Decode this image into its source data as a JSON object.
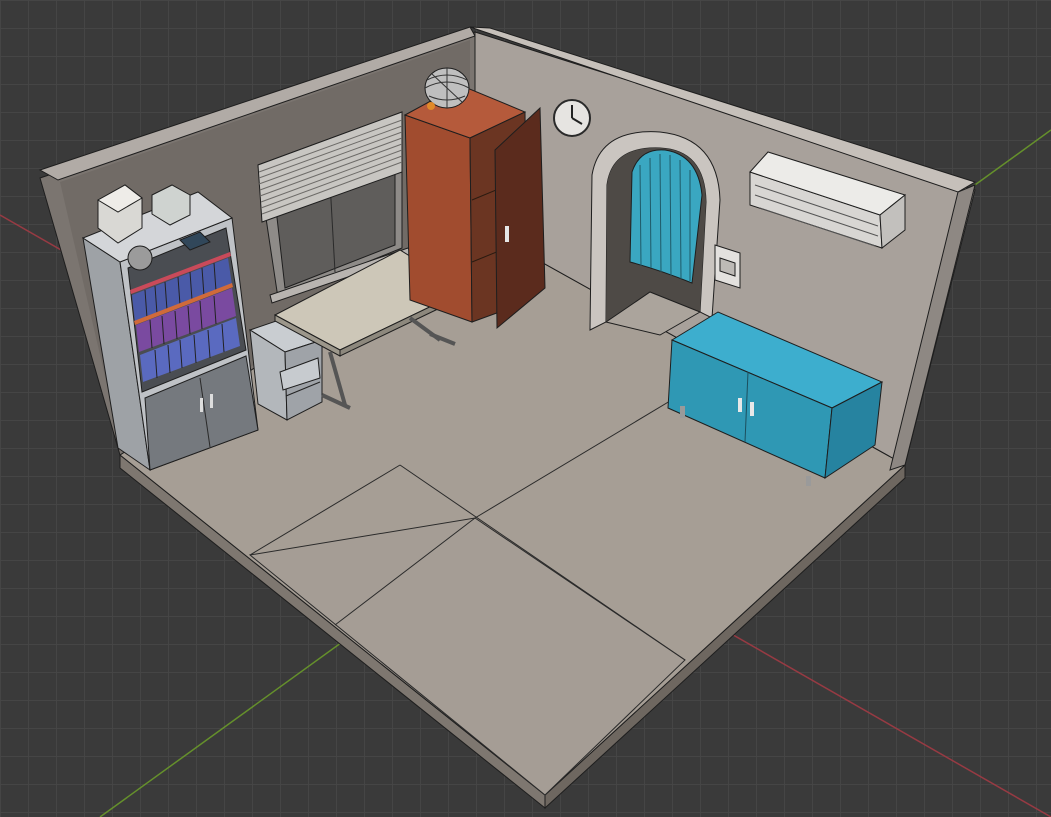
{
  "app": "3D viewport",
  "scene": {
    "type": "isometric room model",
    "objects": [
      {
        "name": "bookshelf",
        "icon": "bookshelf-icon"
      },
      {
        "name": "window-with-blinds",
        "icon": "window-icon"
      },
      {
        "name": "desk",
        "icon": "desk-icon"
      },
      {
        "name": "drawer-unit",
        "icon": "drawer-icon"
      },
      {
        "name": "wardrobe",
        "icon": "wardrobe-icon"
      },
      {
        "name": "globe-lamp",
        "icon": "globe-icon"
      },
      {
        "name": "wall-clock",
        "icon": "clock-icon"
      },
      {
        "name": "arched-doorway-with-curtain",
        "icon": "door-icon"
      },
      {
        "name": "light-switch",
        "icon": "switch-icon"
      },
      {
        "name": "air-conditioner",
        "icon": "ac-icon"
      },
      {
        "name": "cabinet",
        "icon": "cabinet-icon"
      }
    ]
  },
  "colors": {
    "viewport_bg": "#3a3a3a",
    "grid": "#464646",
    "axis_x": "#a23a44",
    "axis_y": "#6a9a2a",
    "floor": "#a69e95",
    "wall": "#a8a19b",
    "wardrobe": "#a14c2f",
    "cabinet": "#2f98b4",
    "curtain": "#3aa7c1",
    "bookshelf": "#b9bcc0"
  }
}
